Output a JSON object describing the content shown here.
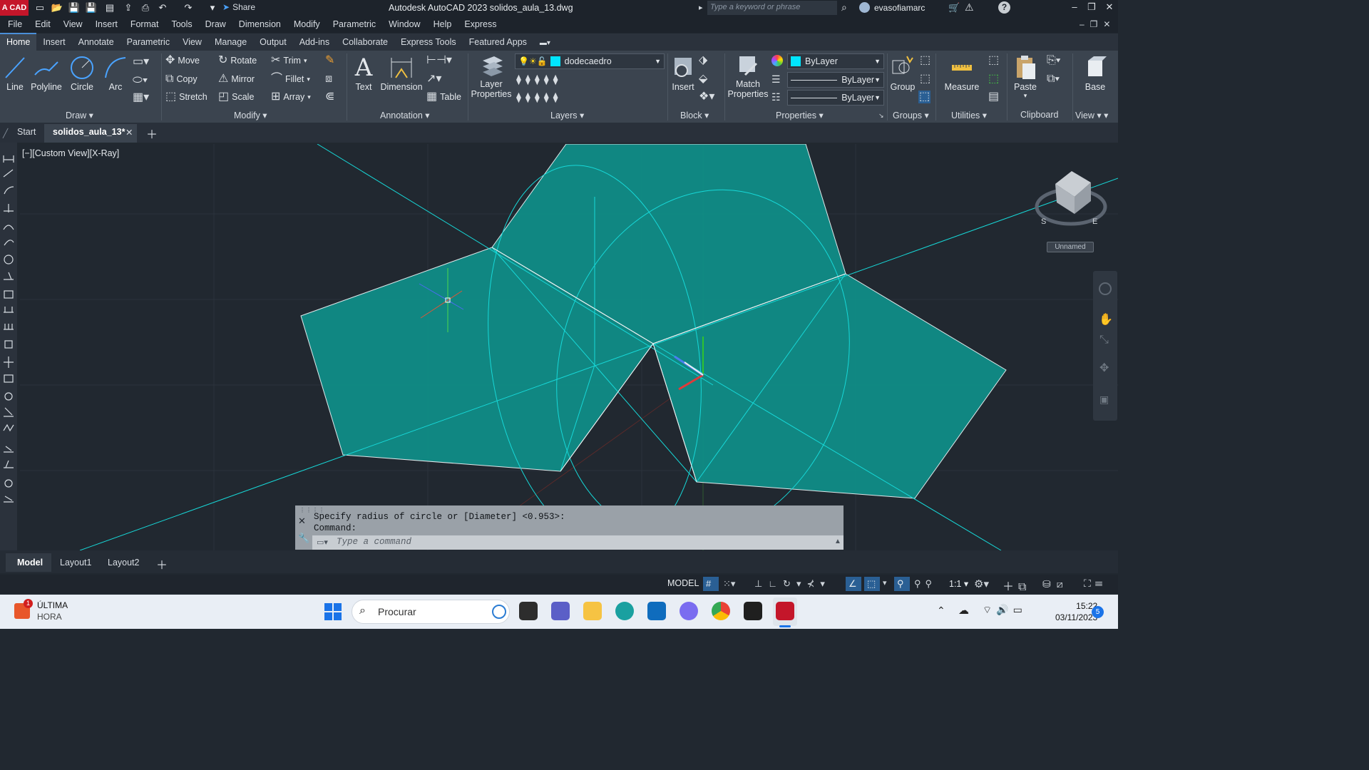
{
  "titlebar": {
    "logo": "A CAD",
    "share_label": "Share",
    "title": "Autodesk AutoCAD 2023    solidos_aula_13.dwg",
    "search_placeholder": "Type a keyword or phrase",
    "username": "evasofiamarc"
  },
  "menubar": [
    "File",
    "Edit",
    "View",
    "Insert",
    "Format",
    "Tools",
    "Draw",
    "Dimension",
    "Modify",
    "Parametric",
    "Window",
    "Help",
    "Express"
  ],
  "ribbon_tabs": [
    "Home",
    "Insert",
    "Annotate",
    "Parametric",
    "View",
    "Manage",
    "Output",
    "Add-ins",
    "Collaborate",
    "Express Tools",
    "Featured Apps"
  ],
  "active_ribbon_tab": "Home",
  "draw": {
    "line": "Line",
    "polyline": "Polyline",
    "circle": "Circle",
    "arc": "Arc",
    "label": "Draw"
  },
  "modify": {
    "move": "Move",
    "rotate": "Rotate",
    "trim": "Trim",
    "copy": "Copy",
    "mirror": "Mirror",
    "fillet": "Fillet",
    "stretch": "Stretch",
    "scale": "Scale",
    "array": "Array",
    "label": "Modify"
  },
  "annotation": {
    "text": "Text",
    "dimension": "Dimension",
    "table": "Table",
    "label": "Annotation"
  },
  "layers": {
    "layer_properties_1": "Layer",
    "layer_properties_2": "Properties",
    "current_layer": "dodecaedro",
    "label": "Layers"
  },
  "block": {
    "insert": "Insert",
    "label": "Block"
  },
  "properties": {
    "match_1": "Match",
    "match_2": "Properties",
    "color": "ByLayer",
    "linetype": "ByLayer",
    "lineweight": "ByLayer",
    "label": "Properties"
  },
  "groups": {
    "group": "Group",
    "label": "Groups"
  },
  "utilities": {
    "measure": "Measure",
    "label": "Utilities"
  },
  "clipboard": {
    "paste": "Paste",
    "label": "Clipboard"
  },
  "view_panel": {
    "base": "Base",
    "label": "View"
  },
  "colors": {
    "accent": "#00e5ff",
    "fill": "#0f8f8a",
    "viewport_bg": "#212830"
  },
  "file_tabs": {
    "start": "Start",
    "current": "solidos_aula_13*"
  },
  "viewport": {
    "label": "[−][Custom View][X-Ray]",
    "viewcube_label": "Unnamed"
  },
  "command": {
    "history": [
      "Specify radius of circle or [Diameter] <0.953>:",
      "Command:"
    ],
    "placeholder": "Type a command"
  },
  "layout_tabs": [
    "Model",
    "Layout1",
    "Layout2"
  ],
  "status": {
    "model": "MODEL",
    "scale": "1:1"
  },
  "taskbar": {
    "news_title": "ÚLTIMA",
    "news_sub": "HORA",
    "news_badge": "1",
    "search": "Procurar",
    "time": "15:22",
    "date": "03/11/2023",
    "notif": "5"
  }
}
